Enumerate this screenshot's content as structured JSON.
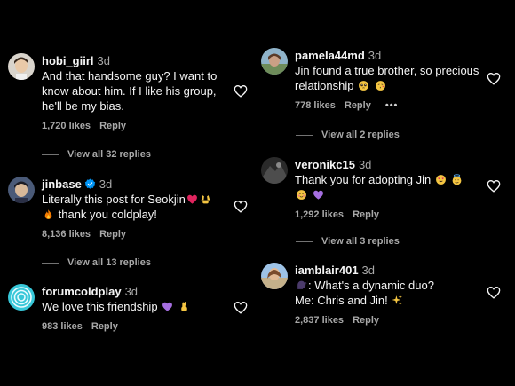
{
  "left_column": [
    {
      "username": "hobi_giirl",
      "time": "3d",
      "text": "And that handsome guy? I want to know about him. If I like his group, he'll be my bias.",
      "likes": "1,720 likes",
      "reply": "Reply",
      "view_replies": "View all 32 replies"
    },
    {
      "username": "jinbase",
      "time": "3d",
      "verified": true,
      "text_before": "Literally this post for Seokjin",
      "text_after": "thank you coldplay!",
      "likes": "8,136 likes",
      "reply": "Reply",
      "view_replies": "View all 13 replies"
    },
    {
      "username": "forumcoldplay",
      "time": "3d",
      "text": "We love this friendship",
      "likes": "983 likes",
      "reply": "Reply"
    }
  ],
  "right_column": [
    {
      "username": "pamela44md",
      "time": "3d",
      "text": "Jin found a true brother, so precious relationship",
      "likes": "778 likes",
      "reply": "Reply",
      "more": "•••",
      "view_replies": "View all 2 replies"
    },
    {
      "username": "veronikc15",
      "time": "3d",
      "text": "Thank you for adopting Jin",
      "likes": "1,292 likes",
      "reply": "Reply",
      "view_replies": "View all 3 replies"
    },
    {
      "username": "iamblair401",
      "time": "3d",
      "text_line1": ": What's a dynamic duo?",
      "text_line2": "Me: Chris and Jin!",
      "likes": "2,837 likes",
      "reply": "Reply"
    }
  ],
  "icons": {
    "like": "heart-outline-icon",
    "verified": "verified-badge-icon",
    "more": "more-options-icon"
  },
  "colors": {
    "background": "#000000",
    "primary_text": "#f5f5f5",
    "secondary_text": "#a8a8a8",
    "verified_blue": "#0095f6",
    "purple_heart": "#a56ee0",
    "red_heart": "#e0245e"
  }
}
